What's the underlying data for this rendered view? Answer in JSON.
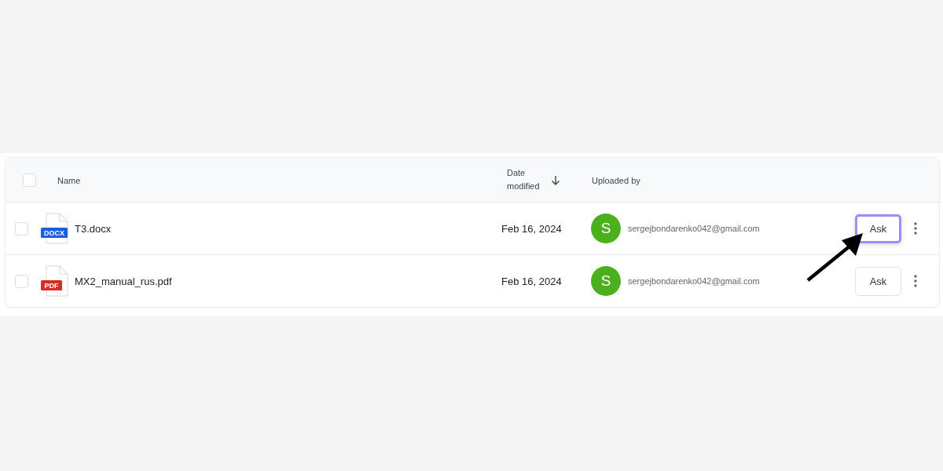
{
  "table": {
    "columns": [
      {
        "label": "Name"
      },
      {
        "label": "Date modified",
        "sorted": true
      },
      {
        "label": "Uploaded by"
      }
    ],
    "select_all": {
      "checked": false
    },
    "rows": [
      {
        "checked": false,
        "badge": "DOCX",
        "color": "#1a5ee6",
        "name": "T3.docx",
        "date": "Feb 16, 2024",
        "avatar": "S",
        "uploader": "sergejbondarenko042@gmail.com",
        "action": "Ask",
        "highlighted": true
      },
      {
        "checked": false,
        "badge": "PDF",
        "color": "#d92b23",
        "name": "MX2_manual_rus.pdf",
        "date": "Feb 16, 2024",
        "avatar": "S",
        "uploader": "sergejbondarenko042@gmail.com",
        "action": "Ask",
        "highlighted": false
      }
    ]
  }
}
